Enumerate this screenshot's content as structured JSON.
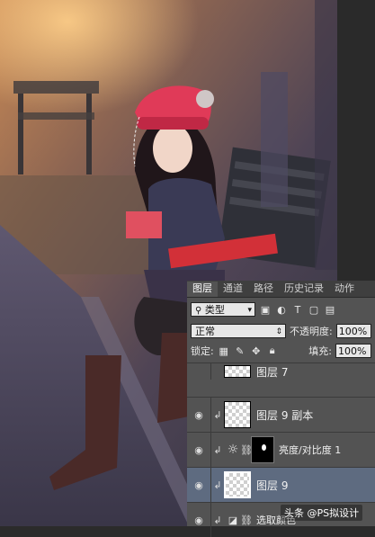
{
  "panel": {
    "tabs": [
      {
        "label": "图层",
        "active": true
      },
      {
        "label": "通道",
        "active": false
      },
      {
        "label": "路径",
        "active": false
      },
      {
        "label": "历史记录",
        "active": false
      },
      {
        "label": "动作",
        "active": false
      }
    ],
    "filter_kind": "类型",
    "blend_mode": "正常",
    "opacity_label": "不透明度:",
    "opacity_value": "100%",
    "lock_label": "锁定:",
    "fill_label": "填充:",
    "fill_value": "100%"
  },
  "layers": [
    {
      "name": "图层 7",
      "visible": false,
      "clipped": false,
      "selected": false
    },
    {
      "name": "图层 9 副本",
      "visible": true,
      "clipped": true,
      "selected": false
    },
    {
      "name": "亮度/对比度 1",
      "visible": true,
      "clipped": true,
      "selected": false,
      "adjustment": true
    },
    {
      "name": "图层 9",
      "visible": true,
      "clipped": true,
      "selected": true
    },
    {
      "name": "选取颜色",
      "visible": true,
      "clipped": true,
      "selected": false,
      "adjustment": true
    }
  ],
  "watermark": "头条 @PS拟设计",
  "colors": {
    "panel_bg": "#535353",
    "selected_row": "#5e6b80",
    "accent_red": "#e03040"
  }
}
